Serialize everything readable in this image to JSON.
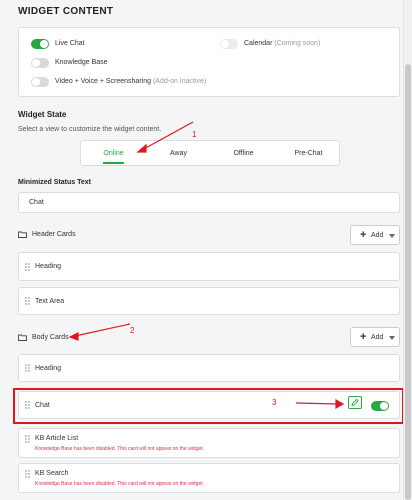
{
  "section_title": "WIDGET CONTENT",
  "content_toggles": [
    {
      "label": "Live Chat",
      "on": true
    },
    {
      "label": "Calendar",
      "note": "(Coming soon)",
      "on": false
    },
    {
      "label": "Knowledge Base",
      "on": false
    },
    {
      "label": "Video + Voice + Screensharing",
      "note": "(Add-on Inactive)",
      "on": false
    }
  ],
  "widget_state": {
    "title": "Widget State",
    "subtitle": "Select a view to customize the widget content.",
    "tabs": [
      "Online",
      "Away",
      "Offline",
      "Pre-Chat"
    ],
    "active_tab": "Online"
  },
  "minimized_status": {
    "label": "Minimized Status Text",
    "value": "Chat"
  },
  "header_cards": {
    "label": "Header Cards",
    "add_label": "Add",
    "items": [
      "Heading",
      "Text Area"
    ]
  },
  "body_cards": {
    "label": "Body Cards",
    "add_label": "Add",
    "items": [
      {
        "label": "Heading"
      },
      {
        "label": "Chat",
        "enabled": true
      },
      {
        "label": "KB Article List",
        "warning": "Knowledge Base has been disabled. This card will not appear on the widget."
      },
      {
        "label": "KB Search",
        "warning": "Knowledge Base has been disabled. This card will not appear on the widget."
      }
    ]
  },
  "annotations": [
    "1",
    "2",
    "3"
  ],
  "colors": {
    "accent": "#28a745",
    "annotation": "#e0181d",
    "warning": "#d9314c"
  }
}
